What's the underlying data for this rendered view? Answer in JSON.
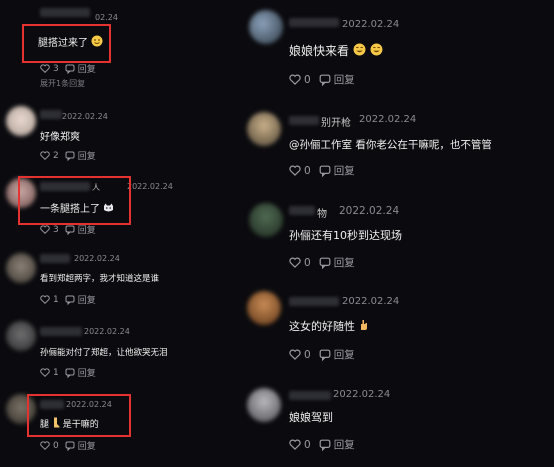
{
  "left": {
    "comments": [
      {
        "text": "腿搭过来了",
        "date": "02.24",
        "likes": "3",
        "reply": "回复",
        "expand": "展开1条回复"
      },
      {
        "text": "好像郑爽",
        "date": "2022.02.24",
        "likes": "2",
        "reply": "回复"
      },
      {
        "text": "一条腿搭上了",
        "date": "2022.02.24",
        "name_suffix": "人",
        "likes": "3",
        "reply": "回复"
      },
      {
        "text": "看到郑超两字，我才知道这是谁",
        "date": "2022.02.24",
        "likes": "1",
        "reply": "回复"
      },
      {
        "text": "孙俪能对付了郑超，让他欲哭无泪",
        "date": "2022.02.24",
        "likes": "1",
        "reply": "回复"
      },
      {
        "text": "腿",
        "text_after": "是干嘛的",
        "date": "2022.02.24",
        "likes": "0",
        "reply": "回复"
      }
    ]
  },
  "right": {
    "comments": [
      {
        "text": "娘娘快来看",
        "date": "2022.02.24",
        "likes": "0",
        "reply": "回复"
      },
      {
        "name_suffix": "别开枪",
        "date": "2022.02.24",
        "text": "@孙俪工作室 看你老公在干嘛呢，也不管管",
        "likes": "0",
        "reply": "回复"
      },
      {
        "name_suffix": "物",
        "date": "2022.02.24",
        "text": "孙俪还有10秒到达现场",
        "likes": "0",
        "reply": "回复"
      },
      {
        "date": "2022.02.24",
        "text": "这女的好随性",
        "likes": "0",
        "reply": "回复"
      },
      {
        "date": "2022.02.24",
        "text": "娘娘驾到",
        "likes": "0",
        "reply": "回复"
      }
    ]
  },
  "colors": {
    "highlight": "#e3322f",
    "background": "#0b0b0f"
  }
}
